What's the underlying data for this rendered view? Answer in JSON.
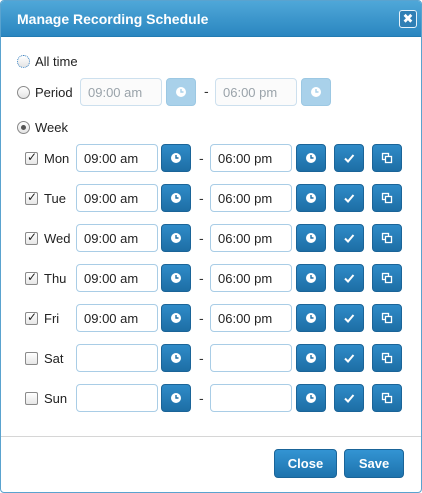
{
  "dialog": {
    "title": "Manage Recording Schedule",
    "close_glyph": "✖"
  },
  "options": {
    "all_time": "All time",
    "period": "Period",
    "week": "Week"
  },
  "period": {
    "start_placeholder": "09:00 am",
    "end_placeholder": "06:00 pm"
  },
  "separator": "-",
  "days": [
    {
      "label": "Mon",
      "checked": true,
      "start": "09:00 am",
      "end": "06:00 pm"
    },
    {
      "label": "Tue",
      "checked": true,
      "start": "09:00 am",
      "end": "06:00 pm"
    },
    {
      "label": "Wed",
      "checked": true,
      "start": "09:00 am",
      "end": "06:00 pm"
    },
    {
      "label": "Thu",
      "checked": true,
      "start": "09:00 am",
      "end": "06:00 pm"
    },
    {
      "label": "Fri",
      "checked": true,
      "start": "09:00 am",
      "end": "06:00 pm"
    },
    {
      "label": "Sat",
      "checked": false,
      "start": "",
      "end": ""
    },
    {
      "label": "Sun",
      "checked": false,
      "start": "",
      "end": ""
    }
  ],
  "footer": {
    "close_label": "Close",
    "save_label": "Save"
  },
  "colors": {
    "accent": "#2a86c0",
    "button": "#1d6ea5",
    "border": "#a9cde6"
  },
  "icons": {
    "clock": "clock-icon",
    "apply": "checkmark-icon",
    "copy": "copy-icon"
  }
}
